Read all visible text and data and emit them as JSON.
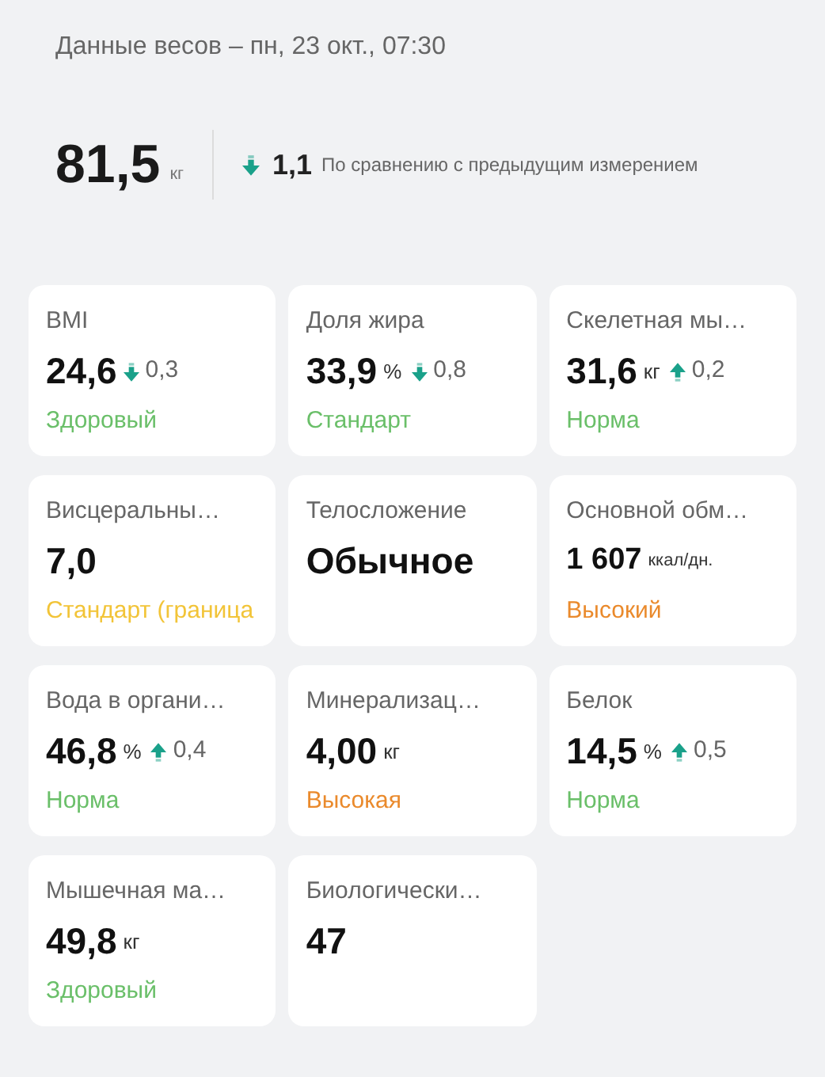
{
  "header": {
    "title": "Данные весов – пн, 23 окт., 07:30"
  },
  "weight": {
    "value": "81,5",
    "unit": "кг",
    "change": {
      "rising": false,
      "value": "1,1"
    },
    "comparison": "По сравнению с предыдущим измерением"
  },
  "metrics": [
    {
      "label": "BMI",
      "value": "24,6",
      "change": {
        "rising": false,
        "value": "0,3"
      },
      "status": {
        "text": "Здоровый",
        "color": "#6abf69"
      }
    },
    {
      "label": "Доля жира",
      "value": "33,9",
      "unit": "%",
      "change": {
        "rising": false,
        "value": "0,8"
      },
      "status": {
        "text": "Стандарт",
        "color": "#6abf69"
      }
    },
    {
      "label": "Скелетная мы…",
      "value": "31,6",
      "unit": "кг",
      "change": {
        "rising": true,
        "value": "0,2"
      },
      "status": {
        "text": "Норма",
        "color": "#6abf69"
      }
    },
    {
      "label": "Висцеральны…",
      "value": "7,0",
      "status": {
        "text": "Стандарт (граница",
        "color": "#f2c438"
      }
    },
    {
      "label": "Телосложение",
      "value": "Обычное"
    },
    {
      "label": "Основной обм…",
      "value": "1 607",
      "unit": "ккал/дн.",
      "status": {
        "text": "Высокий",
        "color": "#ea8a2c"
      }
    },
    {
      "label": "Вода в органи…",
      "value": "46,8",
      "unit": "%",
      "change": {
        "rising": true,
        "value": "0,4"
      },
      "status": {
        "text": "Норма",
        "color": "#6abf69"
      }
    },
    {
      "label": "Минерализац…",
      "value": "4,00",
      "unit": "кг",
      "status": {
        "text": "Высокая",
        "color": "#ea8a2c"
      }
    },
    {
      "label": "Белок",
      "value": "14,5",
      "unit": "%",
      "change": {
        "rising": true,
        "value": "0,5"
      },
      "status": {
        "text": "Норма",
        "color": "#6abf69"
      }
    },
    {
      "label": "Мышечная ма…",
      "value": "49,8",
      "unit": "кг",
      "status": {
        "text": "Здоровый",
        "color": "#6abf69"
      }
    },
    {
      "label": "Биологически…",
      "value": "47"
    }
  ]
}
